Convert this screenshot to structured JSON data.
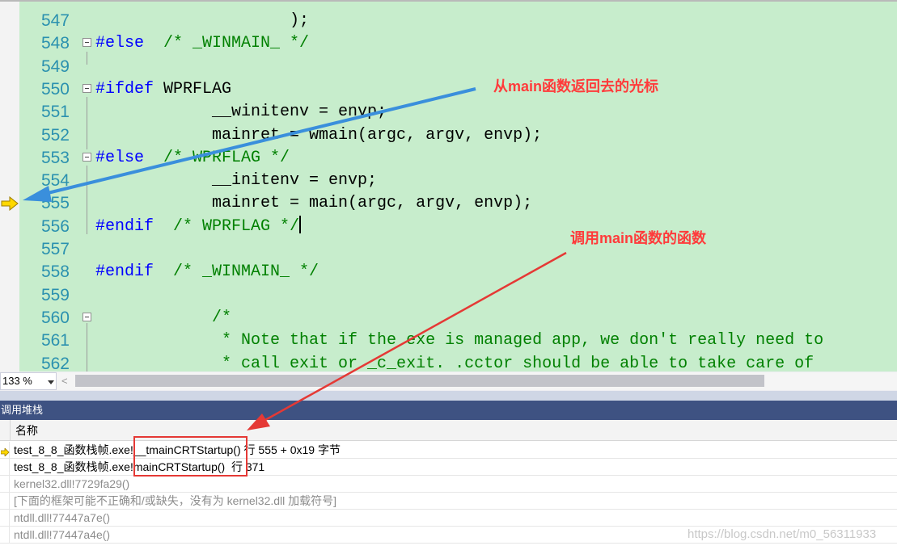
{
  "editor": {
    "lines": [
      {
        "num": "547",
        "fold": false,
        "tokens": [
          {
            "t": "                    );",
            "c": "tx"
          }
        ]
      },
      {
        "num": "548",
        "fold": true,
        "tokens": [
          {
            "t": "#else",
            "c": "kw"
          },
          {
            "t": "  /* _WINMAIN_ */",
            "c": "cm"
          }
        ]
      },
      {
        "num": "549",
        "fold": false,
        "tokens": []
      },
      {
        "num": "550",
        "fold": true,
        "tokens": [
          {
            "t": "#ifdef",
            "c": "kw"
          },
          {
            "t": " WPRFLAG",
            "c": "tx"
          }
        ]
      },
      {
        "num": "551",
        "fold": false,
        "tokens": [
          {
            "t": "            __winitenv = envp;",
            "c": "tx"
          }
        ]
      },
      {
        "num": "552",
        "fold": false,
        "tokens": [
          {
            "t": "            mainret = wmain(argc, argv, envp);",
            "c": "tx"
          }
        ]
      },
      {
        "num": "553",
        "fold": true,
        "tokens": [
          {
            "t": "#else",
            "c": "kw"
          },
          {
            "t": "  /* WPRFLAG */",
            "c": "cm"
          }
        ]
      },
      {
        "num": "554",
        "fold": false,
        "tokens": [
          {
            "t": "            __initenv = envp;",
            "c": "tx"
          }
        ]
      },
      {
        "num": "555",
        "fold": false,
        "tokens": [
          {
            "t": "            mainret = main(argc, argv, envp);",
            "c": "tx"
          }
        ]
      },
      {
        "num": "556",
        "fold": false,
        "tokens": [
          {
            "t": "#endif",
            "c": "kw"
          },
          {
            "t": "  /* WPRFLAG */",
            "c": "cm"
          }
        ],
        "caret": true
      },
      {
        "num": "557",
        "fold": false,
        "tokens": []
      },
      {
        "num": "558",
        "fold": false,
        "tokens": [
          {
            "t": "#endif",
            "c": "kw"
          },
          {
            "t": "  /* _WINMAIN_ */",
            "c": "cm"
          }
        ]
      },
      {
        "num": "559",
        "fold": false,
        "tokens": []
      },
      {
        "num": "560",
        "fold": true,
        "tokens": [
          {
            "t": "            /*",
            "c": "cm"
          }
        ]
      },
      {
        "num": "561",
        "fold": false,
        "tokens": [
          {
            "t": "             * Note that if the exe is managed app, we don't really need to",
            "c": "cm"
          }
        ]
      },
      {
        "num": "562",
        "fold": false,
        "tokens": [
          {
            "t": "             * call exit or _c_exit. .cctor should be able to take care of",
            "c": "cm"
          }
        ]
      }
    ]
  },
  "status": {
    "zoom": "133 %",
    "scroll_left": "<"
  },
  "callstack": {
    "title": "调用堆栈",
    "column_header": "名称",
    "rows": [
      {
        "text": "test_8_8_函数栈帧.exe!__tmainCRTStartup() 行 555 + 0x19 字节",
        "current": true,
        "dim": false
      },
      {
        "text": "test_8_8_函数栈帧.exe!mainCRTStartup()  行 371",
        "current": false,
        "dim": false
      },
      {
        "text": "kernel32.dll!7729fa29()",
        "current": false,
        "dim": true
      },
      {
        "text": "[下面的框架可能不正确和/或缺失，没有为 kernel32.dll 加载符号]",
        "current": false,
        "dim": true
      },
      {
        "text": "ntdll.dll!77447a7e()",
        "current": false,
        "dim": true
      },
      {
        "text": "ntdll.dll!77447a4e()",
        "current": false,
        "dim": true
      }
    ]
  },
  "annotations": {
    "cursor_note": "从main函数返回去的光标",
    "caller_note": "调用main函数的函数"
  },
  "watermark": "https://blog.csdn.net/m0_56311933",
  "colors": {
    "editor_bg": "#c7edcc",
    "line_number": "#2b91af",
    "keyword": "#0000ff",
    "comment": "#008000",
    "panel_title_bg": "#3e5282",
    "annotation_red": "#ff3b3b",
    "arrow_blue": "#3a8fdc",
    "current_marker": "#ffd800"
  }
}
